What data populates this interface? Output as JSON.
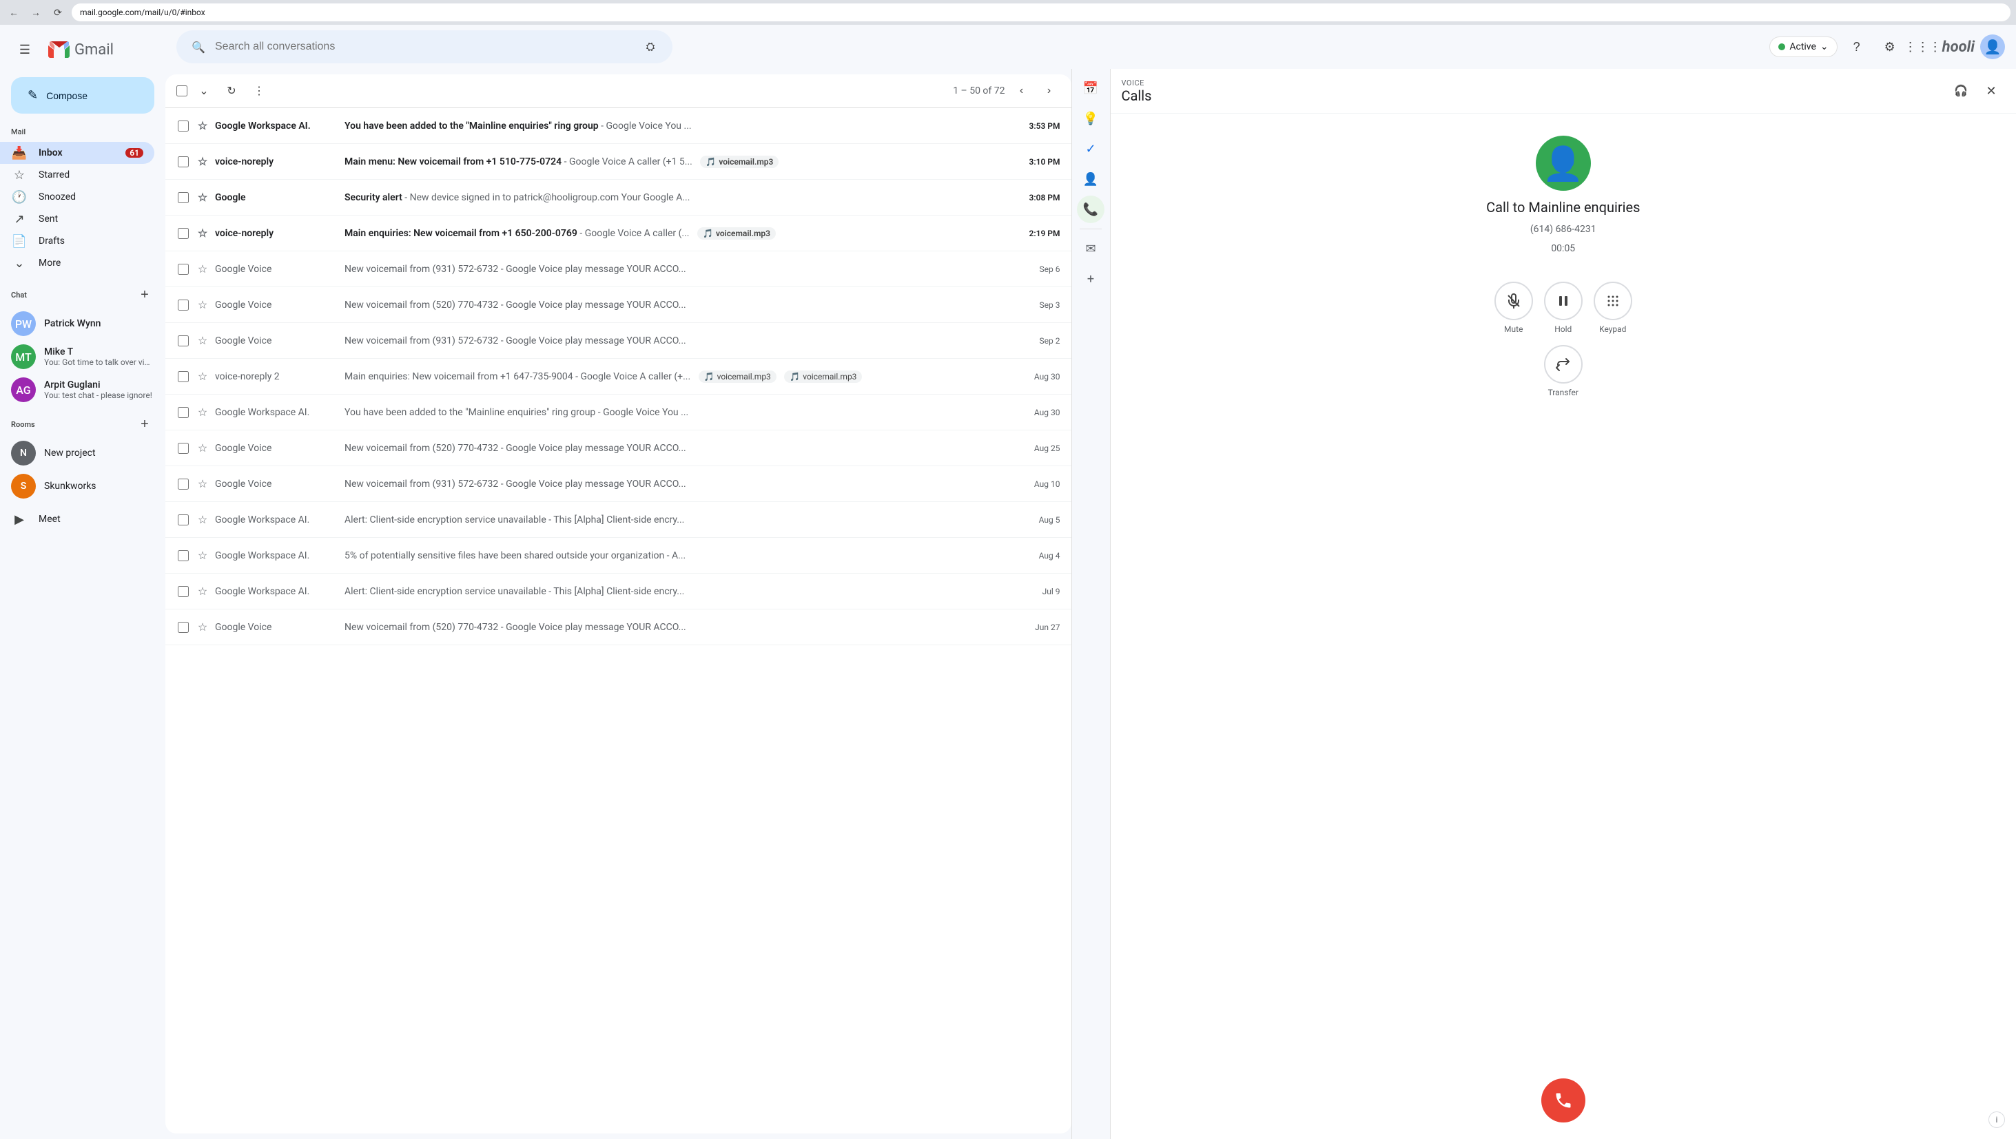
{
  "browser": {
    "url": "mail.google.com/mail/u/0/#inbox",
    "back_disabled": false,
    "forward_disabled": true
  },
  "header": {
    "menu_label": "Main menu",
    "search_placeholder": "Search all conversations",
    "search_filter_label": "Search options",
    "active_label": "Active",
    "help_label": "Help",
    "settings_label": "Settings",
    "apps_label": "Google apps",
    "company": "hooli"
  },
  "sidebar": {
    "compose_label": "Compose",
    "mail_section": "Mail",
    "nav_items": [
      {
        "id": "inbox",
        "label": "Inbox",
        "icon": "📥",
        "badge": "61",
        "active": true
      },
      {
        "id": "starred",
        "label": "Starred",
        "icon": "⭐",
        "badge": ""
      },
      {
        "id": "snoozed",
        "label": "Snoozed",
        "icon": "🕐",
        "badge": ""
      },
      {
        "id": "sent",
        "label": "Sent",
        "icon": "📤",
        "badge": ""
      },
      {
        "id": "drafts",
        "label": "Drafts",
        "icon": "📝",
        "badge": ""
      }
    ],
    "more_label": "More",
    "chat_label": "Chat",
    "chat_add_label": "+",
    "chat_contacts": [
      {
        "id": "patrick",
        "name": "Patrick Wynn",
        "preview": "",
        "color": "#8ab4f8",
        "initials": "PW"
      },
      {
        "id": "mike",
        "name": "Mike T",
        "preview": "You: Got time to talk over vid...",
        "color": "#34a853",
        "initials": "MT"
      },
      {
        "id": "arpit",
        "name": "Arpit Guglani",
        "preview": "You: test chat - please ignore!",
        "color": "#9c27b0",
        "initials": "AG"
      }
    ],
    "rooms_label": "Rooms",
    "rooms_add_label": "+",
    "rooms": [
      {
        "id": "new-project",
        "name": "New project",
        "initials": "N",
        "color": "#5f6368"
      },
      {
        "id": "skunkworks",
        "name": "Skunkworks",
        "initials": "S",
        "color": "#e8710a"
      }
    ],
    "meet_label": "Meet"
  },
  "toolbar": {
    "select_all_label": "Select all",
    "refresh_label": "Refresh",
    "more_options_label": "More options",
    "page_current": "1",
    "page_total": "50",
    "page_of": "of",
    "total_emails": "72",
    "prev_page_label": "Older",
    "next_page_label": "Newer"
  },
  "emails": [
    {
      "id": 1,
      "sender": "Google Workspace AI.",
      "subject": "You have been added to the \"Mainline enquiries\" ring group",
      "snippet": "- Google Voice You ...",
      "time": "3:53 PM",
      "unread": true,
      "starred": false,
      "attachments": []
    },
    {
      "id": 2,
      "sender": "voice-noreply",
      "subject": "Main menu: New voicemail from +1 510-775-0724",
      "snippet": "- Google Voice A caller (+1 5...",
      "time": "3:10 PM",
      "unread": true,
      "starred": false,
      "attachments": [
        "voicemail.mp3"
      ]
    },
    {
      "id": 3,
      "sender": "Google",
      "subject": "Security alert",
      "snippet": "- New device signed in to patrick@hooligroup.com Your Google A...",
      "time": "3:08 PM",
      "unread": true,
      "starred": false,
      "attachments": []
    },
    {
      "id": 4,
      "sender": "voice-noreply",
      "subject": "Main enquiries: New voicemail from +1 650-200-0769",
      "snippet": "- Google Voice A caller (...",
      "time": "2:19 PM",
      "unread": true,
      "starred": false,
      "attachments": [
        "voicemail.mp3"
      ]
    },
    {
      "id": 5,
      "sender": "Google Voice",
      "subject": "New voicemail from (931) 572-6732",
      "snippet": "- Google Voice play message YOUR ACCO...",
      "time": "Sep 6",
      "unread": false,
      "starred": false,
      "attachments": []
    },
    {
      "id": 6,
      "sender": "Google Voice",
      "subject": "New voicemail from (520) 770-4732",
      "snippet": "- Google Voice play message YOUR ACCO...",
      "time": "Sep 3",
      "unread": false,
      "starred": false,
      "attachments": []
    },
    {
      "id": 7,
      "sender": "Google Voice",
      "subject": "New voicemail from (931) 572-6732",
      "snippet": "- Google Voice play message YOUR ACCO...",
      "time": "Sep 2",
      "unread": false,
      "starred": false,
      "attachments": []
    },
    {
      "id": 8,
      "sender": "voice-noreply 2",
      "subject": "Main enquiries: New voicemail from +1 647-735-9004",
      "snippet": "- Google Voice A caller (+...",
      "time": "Aug 30",
      "unread": false,
      "starred": false,
      "attachments": [
        "voicemail.mp3",
        "voicemail.mp3"
      ]
    },
    {
      "id": 9,
      "sender": "Google Workspace AI.",
      "subject": "You have been added to the \"Mainline enquiries\" ring group",
      "snippet": "- Google Voice You ...",
      "time": "Aug 30",
      "unread": false,
      "starred": false,
      "attachments": []
    },
    {
      "id": 10,
      "sender": "Google Voice",
      "subject": "New voicemail from (520) 770-4732",
      "snippet": "- Google Voice play message YOUR ACCO...",
      "time": "Aug 25",
      "unread": false,
      "starred": false,
      "attachments": []
    },
    {
      "id": 11,
      "sender": "Google Voice",
      "subject": "New voicemail from (931) 572-6732",
      "snippet": "- Google Voice play message YOUR ACCO...",
      "time": "Aug 10",
      "unread": false,
      "starred": false,
      "attachments": []
    },
    {
      "id": 12,
      "sender": "Google Workspace AI.",
      "subject": "Alert: Client-side encryption service unavailable",
      "snippet": "- This [Alpha] Client-side encry...",
      "time": "Aug 5",
      "unread": false,
      "starred": false,
      "attachments": []
    },
    {
      "id": 13,
      "sender": "Google Workspace AI.",
      "subject": "5% of potentially sensitive files have been shared outside your organization",
      "snippet": "- A...",
      "time": "Aug 4",
      "unread": false,
      "starred": false,
      "attachments": []
    },
    {
      "id": 14,
      "sender": "Google Workspace AI.",
      "subject": "Alert: Client-side encryption service unavailable",
      "snippet": "- This [Alpha] Client-side encry...",
      "time": "Jul 9",
      "unread": false,
      "starred": false,
      "attachments": []
    },
    {
      "id": 15,
      "sender": "Google Voice",
      "subject": "New voicemail from (520) 770-4732",
      "snippet": "- Google Voice play message YOUR ACCO...",
      "time": "Jun 27",
      "unread": false,
      "starred": false,
      "attachments": []
    }
  ],
  "right_panel_icons": {
    "calendar_icon": "📅",
    "keep_icon": "💡",
    "tasks_icon": "✓",
    "contacts_icon": "👤",
    "phone_icon": "📞",
    "add_icon": "+",
    "email_icon": "✉"
  },
  "voice_panel": {
    "label": "VOICE",
    "title": "Calls",
    "headphone_label": "Audio settings",
    "close_label": "Close",
    "call_name": "Call to Mainline enquiries",
    "call_number": "(614) 686-4231",
    "call_duration": "00:05",
    "controls": {
      "mute_label": "Mute",
      "hold_label": "Hold",
      "keypad_label": "Keypad",
      "transfer_label": "Transfer"
    },
    "end_call_label": "End call",
    "info_label": "More information"
  }
}
